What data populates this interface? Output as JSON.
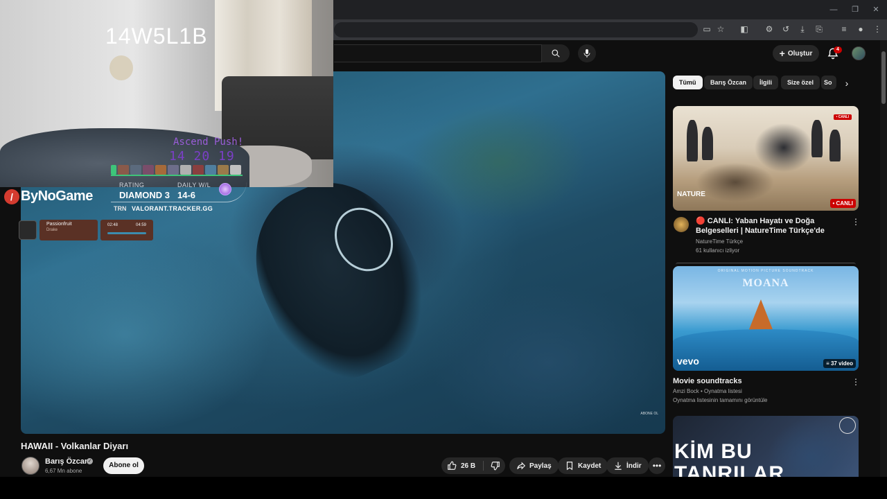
{
  "browser": {
    "window_controls": [
      "—",
      "❐",
      "✕"
    ],
    "toolbar_icons": [
      "cast-icon",
      "star-icon",
      "extension-icon",
      "puzzle-icon",
      "history-icon",
      "download-icon",
      "translate-icon",
      "queue-icon",
      "profile-icon",
      "menu-icon"
    ]
  },
  "header": {
    "create_label": "Oluştur",
    "notifications_count": "4"
  },
  "webcam": {
    "overlay_code": "14W5L1B",
    "push_label": "Ascend Push!",
    "timer": "14 20 19"
  },
  "stream_overlay": {
    "brand": "ByNoGame",
    "rating_label": "RATING",
    "rating_value": "DIAMOND 3",
    "daily_label": "DAILY W/L",
    "daily_value": "14-6",
    "trn_label": "TRN",
    "tracker_url": "VALORANT.TRACKER.GG",
    "music": {
      "title": "Passionfruit",
      "artist": "Drake",
      "time_current": "02:48",
      "time_total": "04:59"
    }
  },
  "video": {
    "watermark": "ABONE OL",
    "title": "HAWAII - Volkanlar Diyarı",
    "channel_name": "Barış Özcan",
    "verified_glyph": "✓",
    "subscribers": "6,67 Mn abone",
    "subscribe_label": "Abone ol",
    "likes": "26 B",
    "share_label": "Paylaş",
    "save_label": "Kaydet",
    "download_label": "İndir",
    "more_glyph": "•••"
  },
  "sidebar": {
    "chips": [
      "Tümü",
      "Barış Özcan",
      "İlgili",
      "Size özel",
      "Sο"
    ],
    "items": [
      {
        "badge_top": "• CANLI",
        "logo_text": "NATURE",
        "badge": "• CANLI",
        "title": "🔴 CANLI: Yaban Hayatı ve Doğa Belgeselleri | NatureTime Türkçe'de",
        "channel": "NatureTime Türkçe",
        "meta": "61 kullanıcı izliyor"
      },
      {
        "thumb_sub": "ORIGINAL MOTION PICTURE SOUNDTRACK",
        "thumb_title": "MOANA",
        "logo_text": "vevo",
        "badge": "≡ 37 video",
        "title": "Movie soundtracks",
        "channel": "Amzi Bock • Oynatma listesi",
        "meta": "Oynatma listesinin tamamını görüntüle"
      },
      {
        "thumb_text": "KİM BU TANRILAR"
      }
    ]
  },
  "colors": {
    "background": "#0f0f0f",
    "accent_red": "#cc0000",
    "chip_active": "#f1f1f1",
    "pill": "#272727",
    "push_purple": "#7b3fc7"
  }
}
